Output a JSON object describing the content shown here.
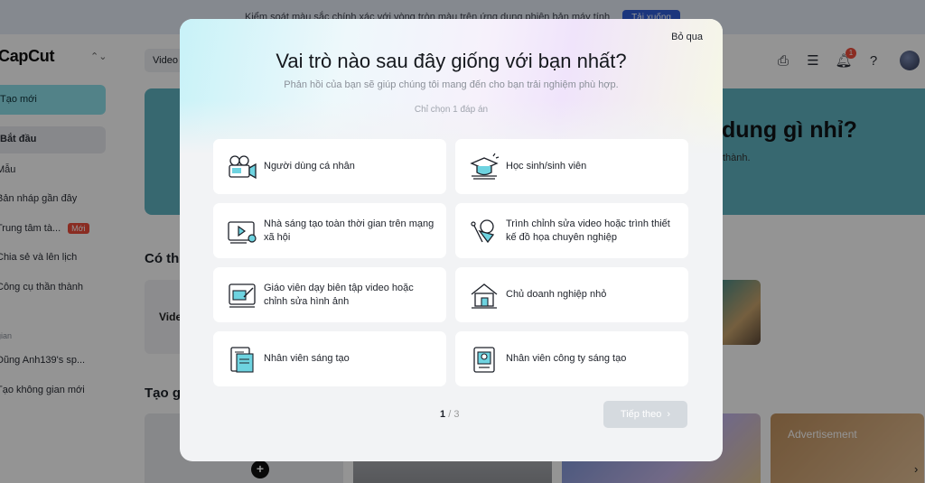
{
  "banner": {
    "text": "Kiểm soát màu sắc chính xác với vòng tròn màu trên ứng dụng phiên bản máy tính",
    "button": "Tải xuống"
  },
  "app": {
    "logo": "CapCut",
    "sidebar": {
      "new_button": "Tạo mới",
      "items": [
        "Bắt đầu",
        "Mẫu",
        "Bản nháp gần đây",
        "Trung tâm tà...",
        "Chia sẻ và lên lịch",
        "Công cụ thần thành"
      ],
      "new_badge": "Mới",
      "section_label": "gian",
      "spaces": [
        "Dũng Anh139's sp...",
        "Tạo không gian mới"
      ]
    },
    "select_value": "Video",
    "notification_count": "1",
    "hero_title": "dung gì nhỉ?",
    "hero_sub": "thành.",
    "section1": "Có th",
    "section2": "Tạo g",
    "card_label": "Vide",
    "ad_label": "Advertisement"
  },
  "modal": {
    "skip": "Bỏ qua",
    "title": "Vai trò nào sau đây giống với bạn nhất?",
    "subtitle": "Phản hồi của bạn sẽ giúp chúng tôi mang đến cho bạn trải nghiệm phù hợp.",
    "hint": "Chỉ chọn 1 đáp án",
    "options": [
      {
        "label": "Người dùng cá nhân",
        "icon": "camera-icon"
      },
      {
        "label": "Học sinh/sinh viên",
        "icon": "graduation-cap-icon"
      },
      {
        "label": "Nhà sáng tạo toàn thời gian trên mạng xã hội",
        "icon": "video-player-icon"
      },
      {
        "label": "Trình chỉnh sửa video hoặc trình thiết kế đồ họa chuyên nghiệp",
        "icon": "design-tools-icon"
      },
      {
        "label": "Giáo viên dạy biên tập video hoặc chỉnh sửa hình ảnh",
        "icon": "teaching-board-icon"
      },
      {
        "label": "Chủ doanh nghiệp nhỏ",
        "icon": "house-icon"
      },
      {
        "label": "Nhân viên sáng tạo",
        "icon": "document-icon"
      },
      {
        "label": "Nhân viên công ty sáng tạo",
        "icon": "id-card-icon"
      }
    ],
    "page_current": "1",
    "page_total": "3",
    "next_button": "Tiếp theo"
  },
  "colors": {
    "accent": "#2f5dd8",
    "hero": "#5fb3c2",
    "sidebar_active": "#8ee0ea",
    "badge": "#ee4c3b"
  }
}
